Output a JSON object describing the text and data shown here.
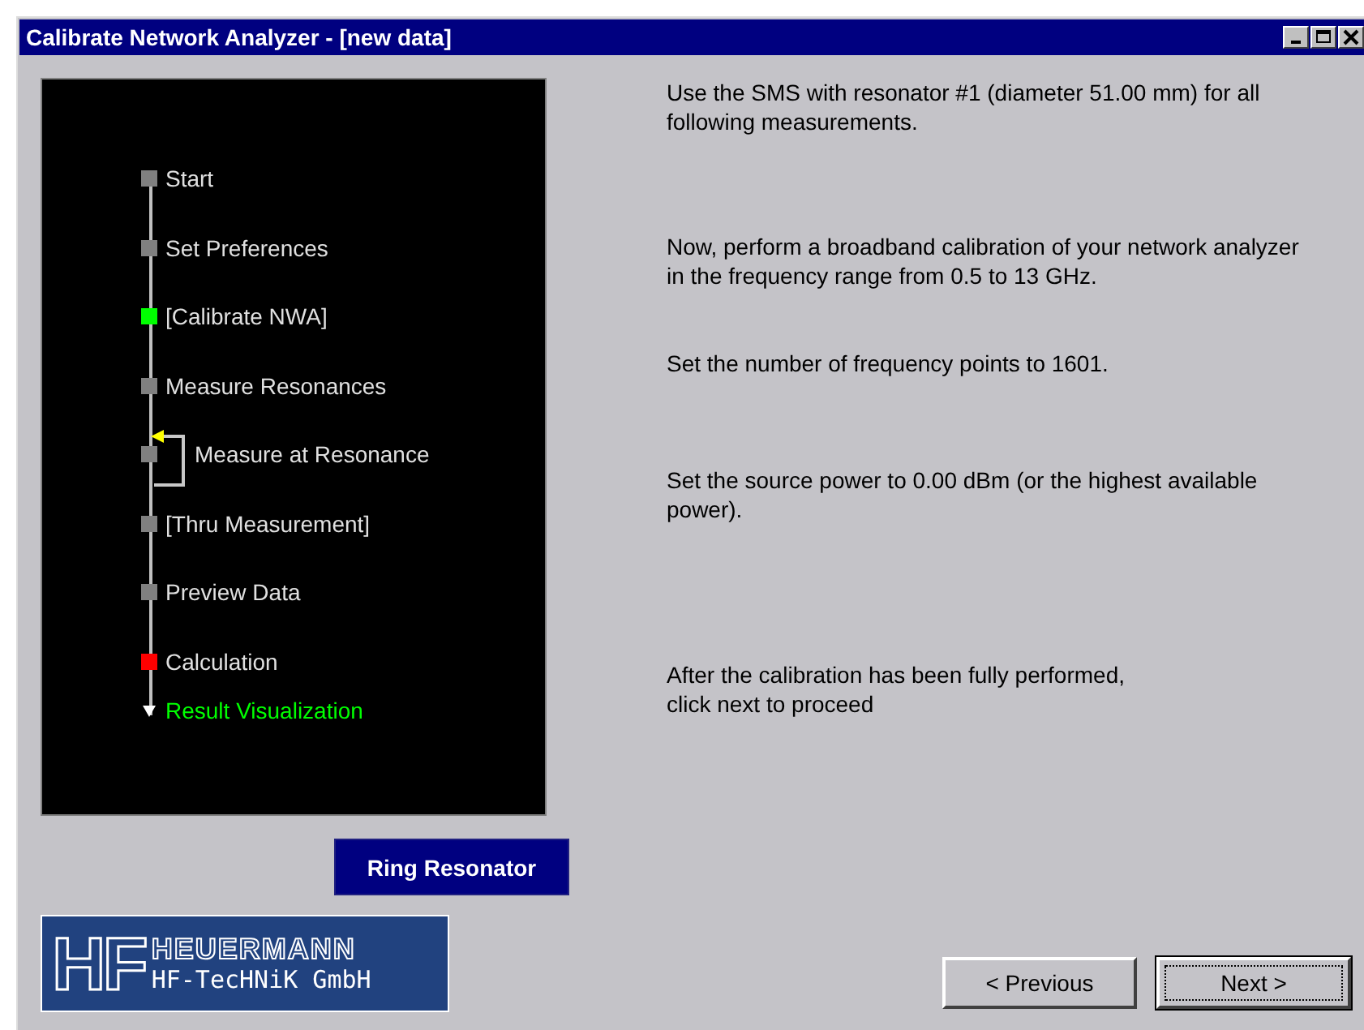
{
  "window": {
    "title": "Calibrate Network Analyzer - [new data]"
  },
  "steps": [
    {
      "label": "Start",
      "kind": "normal",
      "color": "#808080"
    },
    {
      "label": "Set Preferences",
      "kind": "normal",
      "color": "#808080"
    },
    {
      "label": "[Calibrate NWA]",
      "kind": "normal",
      "color": "#00ff00"
    },
    {
      "label": "Measure Resonances",
      "kind": "normal",
      "color": "#808080"
    },
    {
      "label": "Measure at Resonance",
      "kind": "loop",
      "color": "#808080"
    },
    {
      "label": "[Thru Measurement]",
      "kind": "normal",
      "color": "#808080"
    },
    {
      "label": "Preview Data",
      "kind": "normal",
      "color": "#808080"
    },
    {
      "label": "Calculation",
      "kind": "normal",
      "color": "#ff0000"
    },
    {
      "label": "Result Visualization",
      "kind": "final",
      "color": "#00ff00"
    }
  ],
  "mode_button": "Ring Resonator",
  "logo": {
    "mark": "HF",
    "name": "HEUERMANN",
    "company": "HF-TecHNiK GmbH"
  },
  "instructions": [
    "Use the SMS with resonator #1 (diameter 51.00 mm) for all following measurements.",
    "Now, perform a broadband calibration of your network analyzer in the frequency range from 0.5 to 13 GHz.",
    "Set the number of frequency points to 1601.",
    "Set the source power to 0.00 dBm (or the highest available power).",
    "After the calibration has been fully performed,\nclick next to proceed"
  ],
  "buttons": [
    {
      "label": "< Previous",
      "default": false
    },
    {
      "label": "Next >",
      "default": true
    }
  ]
}
